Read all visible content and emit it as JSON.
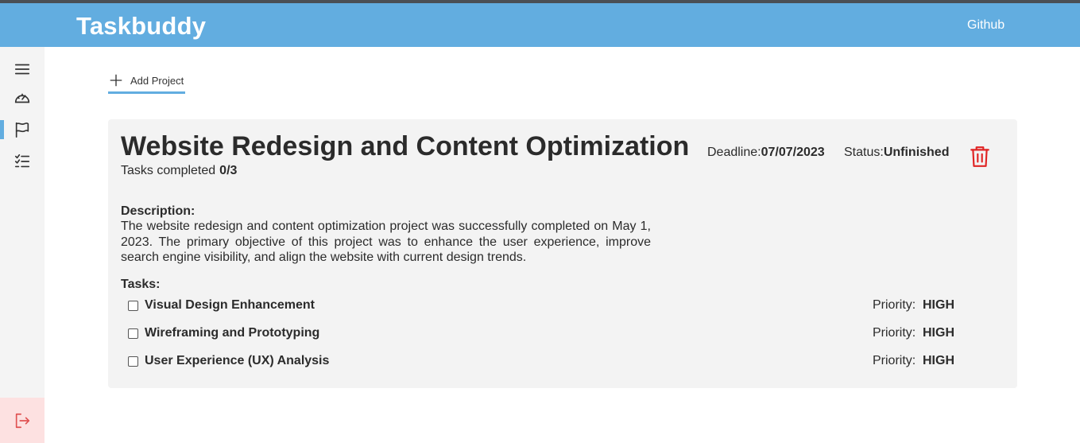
{
  "header": {
    "brand": "Taskbuddy",
    "github_label": "Github"
  },
  "sidebar": {
    "items": [
      {
        "icon": "menu-icon"
      },
      {
        "icon": "dashboard-gauge-icon"
      },
      {
        "icon": "flag-icon",
        "active": true
      },
      {
        "icon": "checklist-icon"
      }
    ],
    "logout_icon": "logout-icon"
  },
  "toolbar": {
    "add_project_label": "Add Project"
  },
  "project": {
    "title": "Website Redesign and Content Optimization",
    "tasks_completed_label": "Tasks completed",
    "tasks_completed_value": "0/3",
    "deadline_label": "Deadline:",
    "deadline_value": "07/07/2023",
    "status_label": "Status:",
    "status_value": "Unfinished",
    "description_label": "Description:",
    "description": "The website redesign and content optimization project was successfully completed on May 1, 2023. The primary objective of this project was to enhance the user experience, improve search engine visibility, and align the website with current design trends.",
    "tasks_label": "Tasks:",
    "tasks": [
      {
        "name": "Visual Design Enhancement",
        "priority_label": "Priority:",
        "priority": "HIGH",
        "done": false
      },
      {
        "name": "Wireframing and Prototyping",
        "priority_label": "Priority:",
        "priority": "HIGH",
        "done": false
      },
      {
        "name": "User Experience (UX) Analysis",
        "priority_label": "Priority:",
        "priority": "HIGH",
        "done": false
      }
    ]
  },
  "colors": {
    "header_bg": "#62ade0",
    "delete_icon": "#e02424",
    "logout_bg": "#fde1e1",
    "logout_icon": "#e05252"
  }
}
